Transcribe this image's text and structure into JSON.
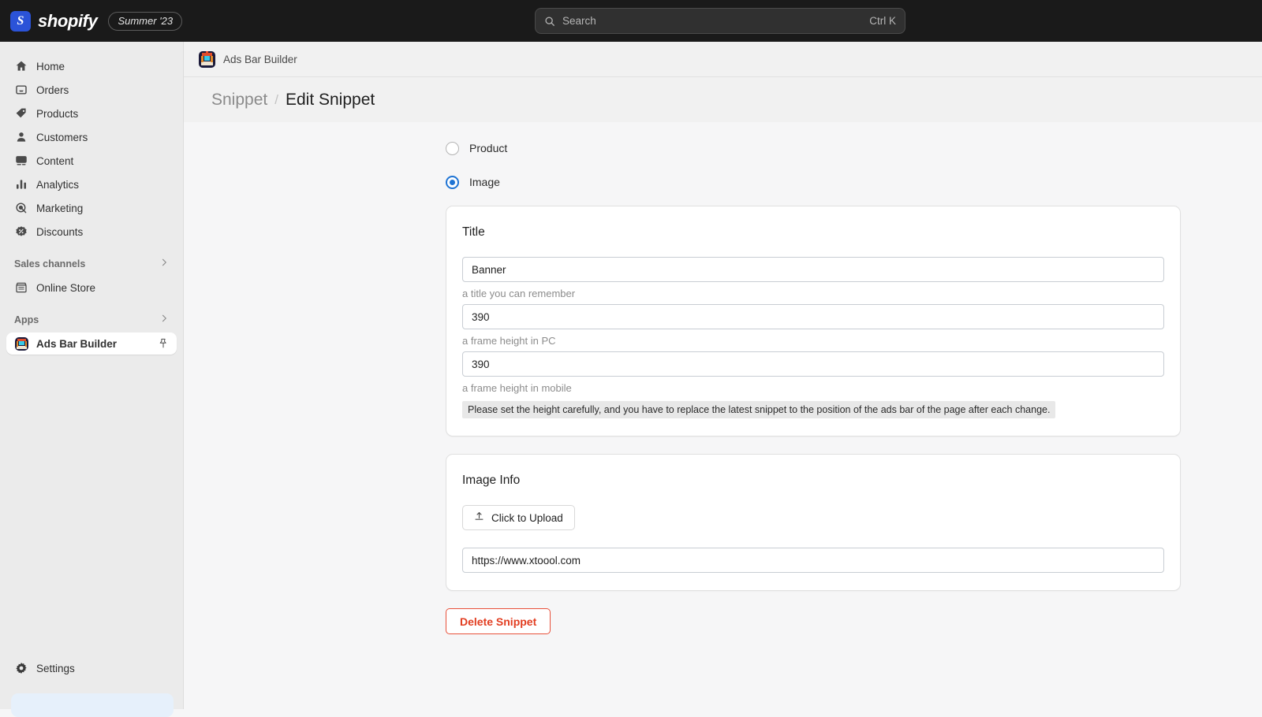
{
  "topbar": {
    "brand_name": "shopify",
    "season_badge": "Summer '23",
    "search_placeholder": "Search",
    "search_shortcut": "Ctrl K"
  },
  "sidebar": {
    "items": [
      {
        "label": "Home",
        "icon": "home-icon"
      },
      {
        "label": "Orders",
        "icon": "orders-inbox-icon"
      },
      {
        "label": "Products",
        "icon": "product-tag-icon"
      },
      {
        "label": "Customers",
        "icon": "customer-person-icon"
      },
      {
        "label": "Content",
        "icon": "content-image-icon"
      },
      {
        "label": "Analytics",
        "icon": "analytics-bars-icon"
      },
      {
        "label": "Marketing",
        "icon": "marketing-target-icon"
      },
      {
        "label": "Discounts",
        "icon": "discount-badge-icon"
      }
    ],
    "sales_channels_label": "Sales channels",
    "online_store_label": "Online Store",
    "apps_label": "Apps",
    "app_item_label": "Ads Bar Builder",
    "settings_label": "Settings"
  },
  "app_header": {
    "app_name": "Ads Bar Builder"
  },
  "breadcrumb": {
    "previous": "Snippet",
    "separator": "/",
    "current": "Edit Snippet"
  },
  "main": {
    "type_options": [
      {
        "label": "Product",
        "selected": false
      },
      {
        "label": "Image",
        "selected": true
      }
    ],
    "title_card": {
      "heading": "Title",
      "title_value": "Banner",
      "title_help": "a title you can remember",
      "pc_height_value": "390",
      "pc_height_help": "a frame height in PC",
      "mobile_height_value": "390",
      "mobile_height_help": "a frame height in mobile",
      "note": "Please set the height carefully, and you have to replace the latest snippet to the position of the ads bar of the page after each change."
    },
    "image_card": {
      "heading": "Image Info",
      "upload_label": "Click to Upload",
      "upload_icon": "upload-icon",
      "image_url": "https://www.xtoool.com"
    },
    "delete_label": "Delete Snippet"
  },
  "colors": {
    "accent_blue": "#1f74d4",
    "danger_red": "#e23d20",
    "topbar_bg": "#1a1a1a",
    "sidebar_bg": "#ebebeb",
    "page_bg": "#f6f6f7"
  }
}
